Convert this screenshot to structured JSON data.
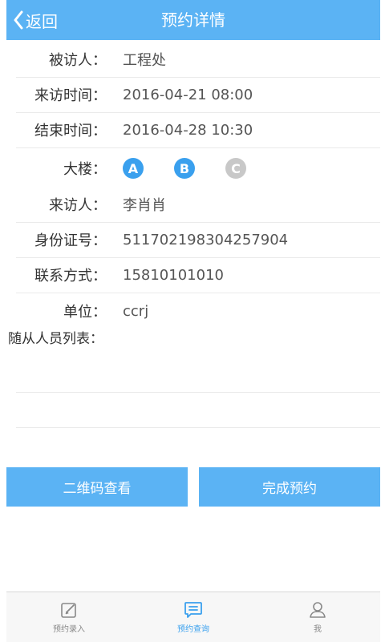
{
  "header": {
    "back_label": "返回",
    "title": "预约详情"
  },
  "details": [
    {
      "label": "被访人：",
      "value": "工程处"
    },
    {
      "label": "来访时间：",
      "value": "2016-04-21 08:00"
    },
    {
      "label": "结束时间：",
      "value": "2016-04-28 10:30"
    },
    {
      "label": "大楼：",
      "value": ""
    },
    {
      "label": "来访人：",
      "value": "李肖肖"
    },
    {
      "label": "身份证号：",
      "value": "511702198304257904"
    },
    {
      "label": "联系方式：",
      "value": "15810101010"
    },
    {
      "label": "单位：",
      "value": "ccrj"
    }
  ],
  "buildings": [
    {
      "letter": "A",
      "selected": true
    },
    {
      "letter": "B",
      "selected": true
    },
    {
      "letter": "C",
      "selected": false
    }
  ],
  "companions_label": "随从人员列表：",
  "buttons": {
    "qrcode": "二维码查看",
    "complete": "完成预约"
  },
  "tabbar": [
    {
      "label": "预约录入",
      "icon": "edit-icon",
      "active": false
    },
    {
      "label": "预约查询",
      "icon": "message-list-icon",
      "active": true
    },
    {
      "label": "我",
      "icon": "person-icon",
      "active": false
    }
  ],
  "colors": {
    "accent": "#5bb3f4",
    "building_selected": "#3aa0ee",
    "building_unselected": "#c8c8c8",
    "tab_active": "#3aa0ee",
    "tab_inactive": "#888888"
  }
}
